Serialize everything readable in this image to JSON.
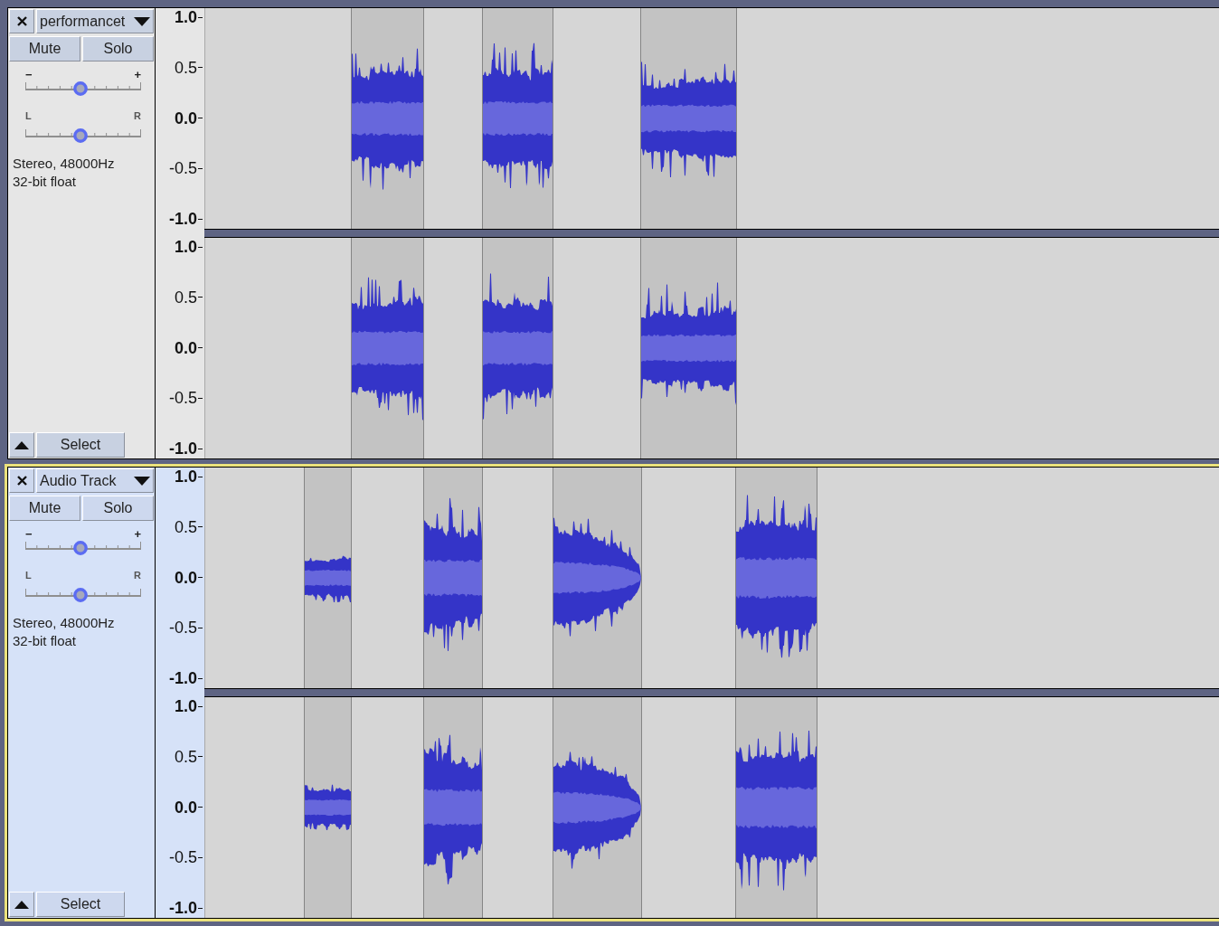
{
  "tracks": [
    {
      "name": "performancet",
      "selected": false,
      "mute_label": "Mute",
      "solo_label": "Solo",
      "gain": {
        "min_label": "−",
        "max_label": "+",
        "level": 0.48
      },
      "pan": {
        "min_label": "L",
        "max_label": "R",
        "level": 0.48
      },
      "info": [
        "Stereo, 48000Hz",
        "32-bit float"
      ],
      "select_label": "Select",
      "channels": [
        {
          "ruler": [
            {
              "label": "1.0",
              "major": true
            },
            {
              "label": "0.5",
              "major": false
            },
            {
              "label": "0.0",
              "major": true
            },
            {
              "label": "-0.5",
              "major": false
            },
            {
              "label": "-1.0",
              "major": true
            }
          ]
        },
        {
          "ruler": [
            {
              "label": "1.0",
              "major": true
            },
            {
              "label": "0.5",
              "major": false
            },
            {
              "label": "0.0",
              "major": true
            },
            {
              "label": "-0.5",
              "major": false
            },
            {
              "label": "-1.0",
              "major": true
            }
          ]
        }
      ]
    },
    {
      "name": "Audio Track",
      "selected": true,
      "mute_label": "Mute",
      "solo_label": "Solo",
      "gain": {
        "min_label": "−",
        "max_label": "+",
        "level": 0.48
      },
      "pan": {
        "min_label": "L",
        "max_label": "R",
        "level": 0.48
      },
      "info": [
        "Stereo, 48000Hz",
        "32-bit float"
      ],
      "select_label": "Select",
      "channels": [
        {
          "ruler": [
            {
              "label": "1.0",
              "major": true
            },
            {
              "label": "0.5",
              "major": false
            },
            {
              "label": "0.0",
              "major": true
            },
            {
              "label": "-0.5",
              "major": false
            },
            {
              "label": "-1.0",
              "major": true
            }
          ]
        },
        {
          "ruler": [
            {
              "label": "1.0",
              "major": true
            },
            {
              "label": "0.5",
              "major": false
            },
            {
              "label": "0.0",
              "major": true
            },
            {
              "label": "-0.5",
              "major": false
            },
            {
              "label": "-1.0",
              "major": true
            }
          ]
        }
      ]
    }
  ]
}
